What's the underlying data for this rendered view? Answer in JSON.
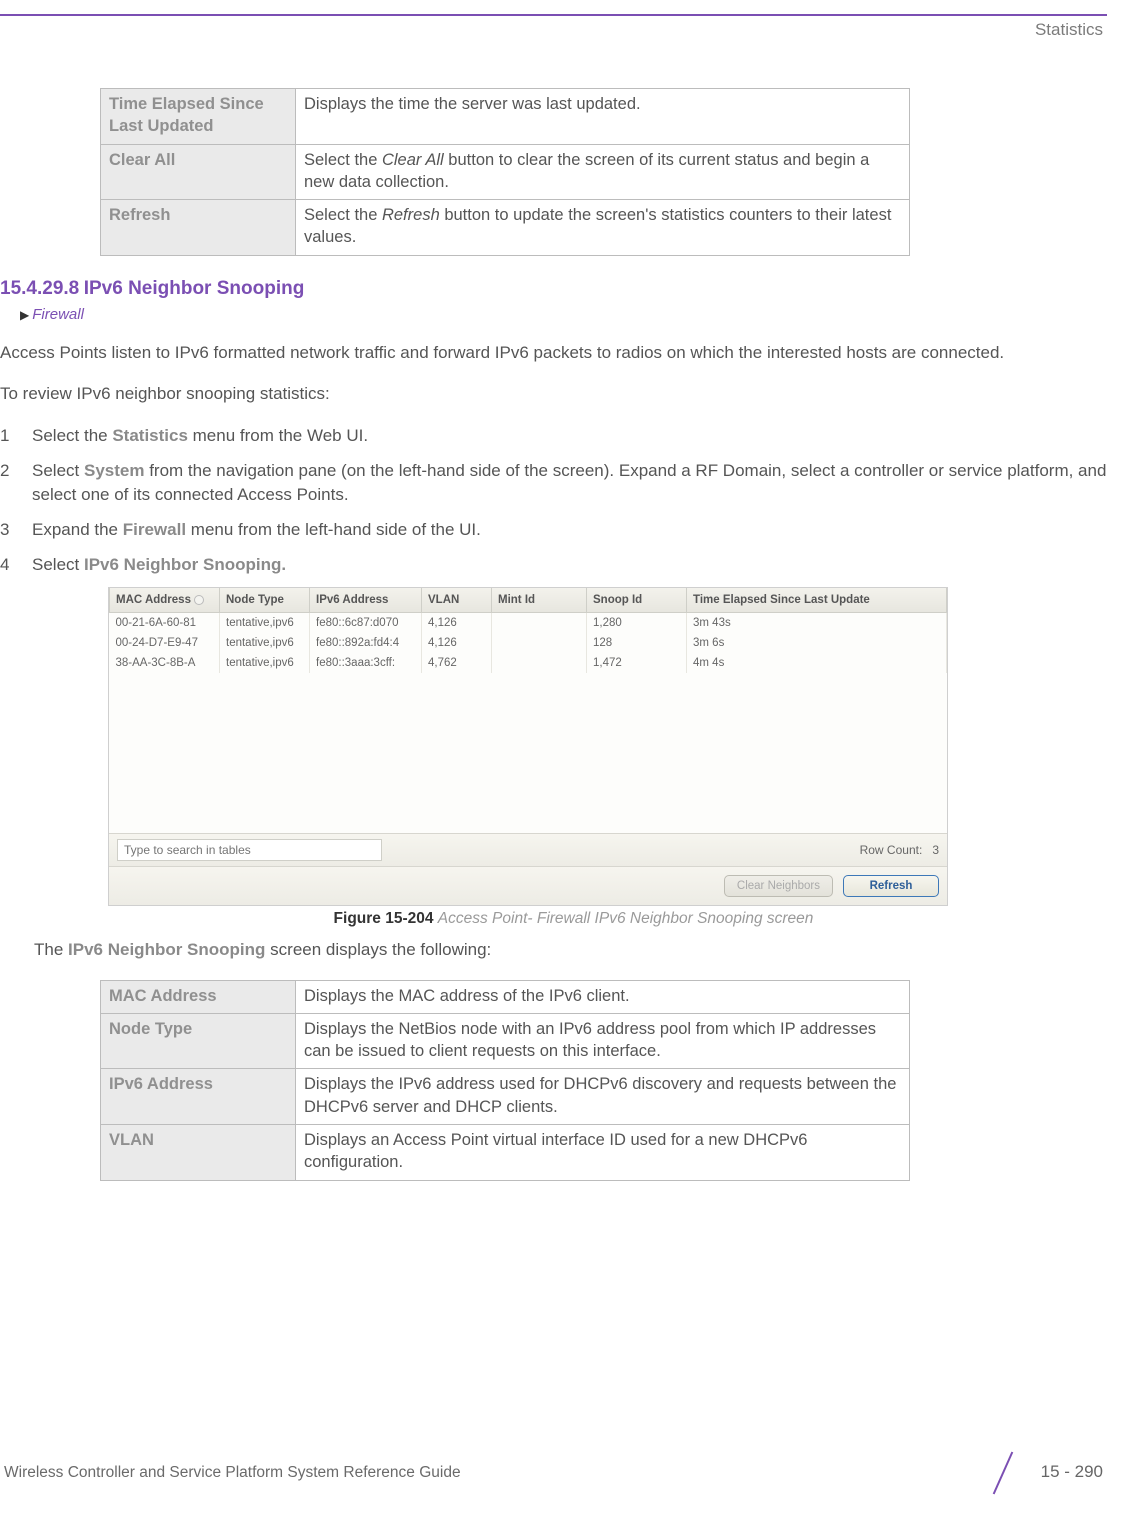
{
  "header": {
    "section": "Statistics"
  },
  "table_top": {
    "rows": [
      {
        "label": "Time Elapsed Since Last Updated",
        "desc": "Displays the time the server was last updated."
      },
      {
        "label": "Clear All",
        "desc_pre": "Select the ",
        "desc_em": "Clear All",
        "desc_post": " button to clear the screen of its current status and begin a new data collection."
      },
      {
        "label": "Refresh",
        "desc_pre": "Select the ",
        "desc_em": "Refresh",
        "desc_post": " button to update the screen's statistics counters to their latest values."
      }
    ]
  },
  "section": {
    "number": "15.4.29.8",
    "title": "IPv6 Neighbor Snooping",
    "breadcrumb": "Firewall"
  },
  "para1": "Access Points listen to IPv6 formatted network traffic and forward IPv6 packets to radios on which the interested hosts are connected.",
  "para2": "To review IPv6 neighbor snooping statistics:",
  "steps": [
    {
      "num": "1",
      "pre": "Select the ",
      "bold": "Statistics",
      "post": " menu from the Web UI."
    },
    {
      "num": "2",
      "pre": "Select ",
      "bold": "System",
      "post": " from the navigation pane (on the left-hand side of the screen). Expand a RF Domain, select a controller or service platform, and select one of its connected Access Points."
    },
    {
      "num": "3",
      "pre": "Expand the ",
      "bold": "Firewall",
      "post": " menu from the left-hand side of the UI."
    },
    {
      "num": "4",
      "pre": "Select ",
      "bold": "IPv6 Neighbor Snooping.",
      "post": ""
    }
  ],
  "ui": {
    "columns": [
      "MAC Address",
      "Node Type",
      "IPv6 Address",
      "VLAN",
      "Mint Id",
      "Snoop Id",
      "Time Elapsed Since Last Update"
    ],
    "rows": [
      {
        "mac": "00-21-6A-60-81",
        "node": "tentative,ipv6",
        "ip": "fe80::6c87:d070",
        "vlan": "4,126",
        "mint": "",
        "snoop": "1,280",
        "time": "3m 43s"
      },
      {
        "mac": "00-24-D7-E9-47",
        "node": "tentative,ipv6",
        "ip": "fe80::892a:fd4:4",
        "vlan": "4,126",
        "mint": "",
        "snoop": "128",
        "time": "3m 6s"
      },
      {
        "mac": "38-AA-3C-8B-A",
        "node": "tentative,ipv6",
        "ip": "fe80::3aaa:3cff:",
        "vlan": "4,762",
        "mint": "",
        "snoop": "1,472",
        "time": "4m 4s"
      }
    ],
    "search_placeholder": "Type to search in tables",
    "rowcount_label": "Row Count:",
    "rowcount_value": "3",
    "btn_clear": "Clear Neighbors",
    "btn_refresh": "Refresh"
  },
  "figure": {
    "num": "Figure 15-204",
    "text": "Access Point- Firewall IPv6 Neighbor Snooping screen"
  },
  "post_figure_pre": "The ",
  "post_figure_bold": "IPv6 Neighbor Snooping",
  "post_figure_post": " screen displays the following:",
  "table_bottom": {
    "rows": [
      {
        "label": "MAC Address",
        "desc": "Displays the MAC address of the IPv6 client."
      },
      {
        "label": "Node Type",
        "desc": "Displays the NetBios node with an IPv6 address pool from which IP addresses can be issued to client requests on this interface."
      },
      {
        "label": "IPv6 Address",
        "desc": "Displays the IPv6 address used for DHCPv6 discovery and requests between the DHCPv6 server and DHCP clients."
      },
      {
        "label": "VLAN",
        "desc": "Displays an Access Point virtual interface ID used for a new DHCPv6 configuration."
      }
    ]
  },
  "footer": {
    "book": "Wireless Controller and Service Platform System Reference Guide",
    "page": "15 - 290"
  }
}
